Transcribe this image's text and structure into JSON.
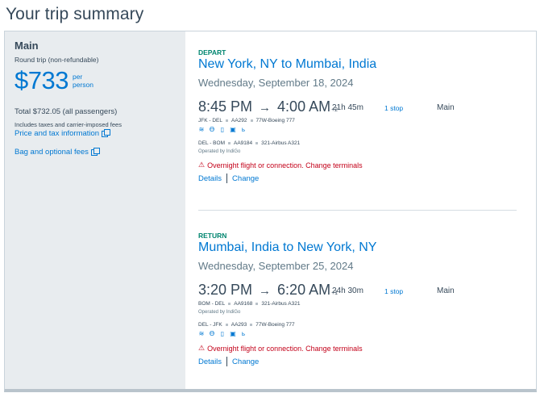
{
  "page": {
    "title": "Your trip summary"
  },
  "summary": {
    "cabin": "Main",
    "trip_type": "Round trip (non-refundable)",
    "price": "$733",
    "per_line1": "per",
    "per_line2": "person",
    "total": "Total $732.05 (all passengers)",
    "taxes_note": "Includes taxes and carrier-imposed fees",
    "price_tax_link": "Price and tax information",
    "bag_fees_link": "Bag and optional fees"
  },
  "segments": [
    {
      "label": "DEPART",
      "route": "New York, NY to Mumbai, India",
      "date": "Wednesday, September 18, 2024",
      "depart_time": "8:45 PM",
      "arrow": "→",
      "arrive_time": "4:00 AM",
      "day_offset": "+2",
      "duration": "21h 45m",
      "stops": "1 stop",
      "cabin": "Main",
      "leg1": {
        "route": "JFK - DEL",
        "flight": "AA292",
        "aircraft": "77W-Boeing 777"
      },
      "leg2": {
        "route": "DEL - BOM",
        "flight": "AA9184",
        "aircraft": "321-Airbus A321"
      },
      "operated_by": "Operated by IndiGo",
      "warning": "Overnight flight or connection. Change terminals",
      "details": "Details",
      "change": "Change"
    },
    {
      "label": "RETURN",
      "route": "Mumbai, India to New York, NY",
      "date": "Wednesday, September 25, 2024",
      "depart_time": "3:20 PM",
      "arrow": "→",
      "arrive_time": "6:20 AM",
      "day_offset": "+1",
      "duration": "24h 30m",
      "stops": "1 stop",
      "cabin": "Main",
      "leg1": {
        "route": "BOM - DEL",
        "flight": "AA9168",
        "aircraft": "321-Airbus A321"
      },
      "leg2": {
        "route": "DEL - JFK",
        "flight": "AA293",
        "aircraft": "77W-Boeing 777"
      },
      "operated_by": "Operated by IndiGo",
      "warning": "Overnight flight or connection. Change terminals",
      "details": "Details",
      "change": "Change"
    }
  ],
  "icons": {
    "wifi": "wifi-icon",
    "power": "power-icon",
    "usb": "usb-icon",
    "entertainment": "entertainment-icon",
    "seat": "seat-icon",
    "warning": "warning-icon",
    "external": "external-link-icon"
  },
  "colors": {
    "brand_blue": "#0078d2",
    "green": "#00856f",
    "warning_red": "#c30019",
    "panel_gray": "#e8ecef"
  }
}
